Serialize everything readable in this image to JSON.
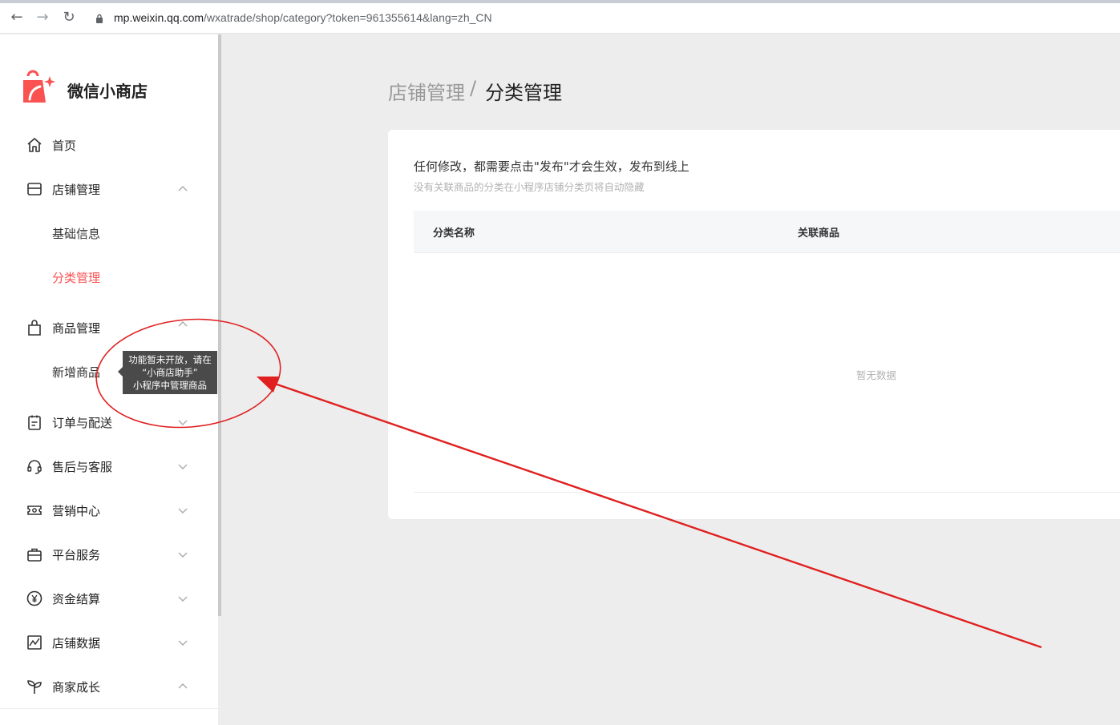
{
  "browser": {
    "url_host": "mp.weixin.qq.com",
    "url_path": "/wxatrade/shop/category?token=961355614&lang=zh_CN"
  },
  "app": {
    "name": "微信小商店",
    "brand_color": "#fa5151"
  },
  "sidebar": {
    "items": [
      {
        "label": "首页",
        "icon": "home-icon"
      },
      {
        "label": "店铺管理",
        "icon": "shop-icon",
        "expanded": true,
        "children": [
          {
            "label": "基础信息"
          },
          {
            "label": "分类管理",
            "active": true
          }
        ]
      },
      {
        "label": "商品管理",
        "icon": "bag-icon",
        "expanded": true,
        "children": [
          {
            "label": "新增商品"
          }
        ]
      },
      {
        "label": "订单与配送",
        "icon": "order-icon"
      },
      {
        "label": "售后与客服",
        "icon": "headset-icon"
      },
      {
        "label": "营销中心",
        "icon": "ticket-icon"
      },
      {
        "label": "平台服务",
        "icon": "briefcase-icon"
      },
      {
        "label": "资金结算",
        "icon": "yuan-icon"
      },
      {
        "label": "店铺数据",
        "icon": "chart-icon"
      },
      {
        "label": "商家成长",
        "icon": "sprout-icon"
      }
    ]
  },
  "tooltip": {
    "line1": "功能暂未开放，请在",
    "line2": "“小商店助手”",
    "line3": "小程序中管理商品"
  },
  "breadcrumb": {
    "parent": "店铺管理",
    "separator": "/",
    "current": "分类管理"
  },
  "main": {
    "notice": "任何修改，都需要点击\"发布\"才会生效，发布到线上",
    "notice_sub": "没有关联商品的分类在小程序店铺分类页将自动隐藏",
    "table": {
      "columns": [
        "分类名称",
        "关联商品"
      ],
      "rows": [],
      "empty_text": "暂无数据"
    }
  },
  "annotation": {
    "color": "#e02020"
  }
}
